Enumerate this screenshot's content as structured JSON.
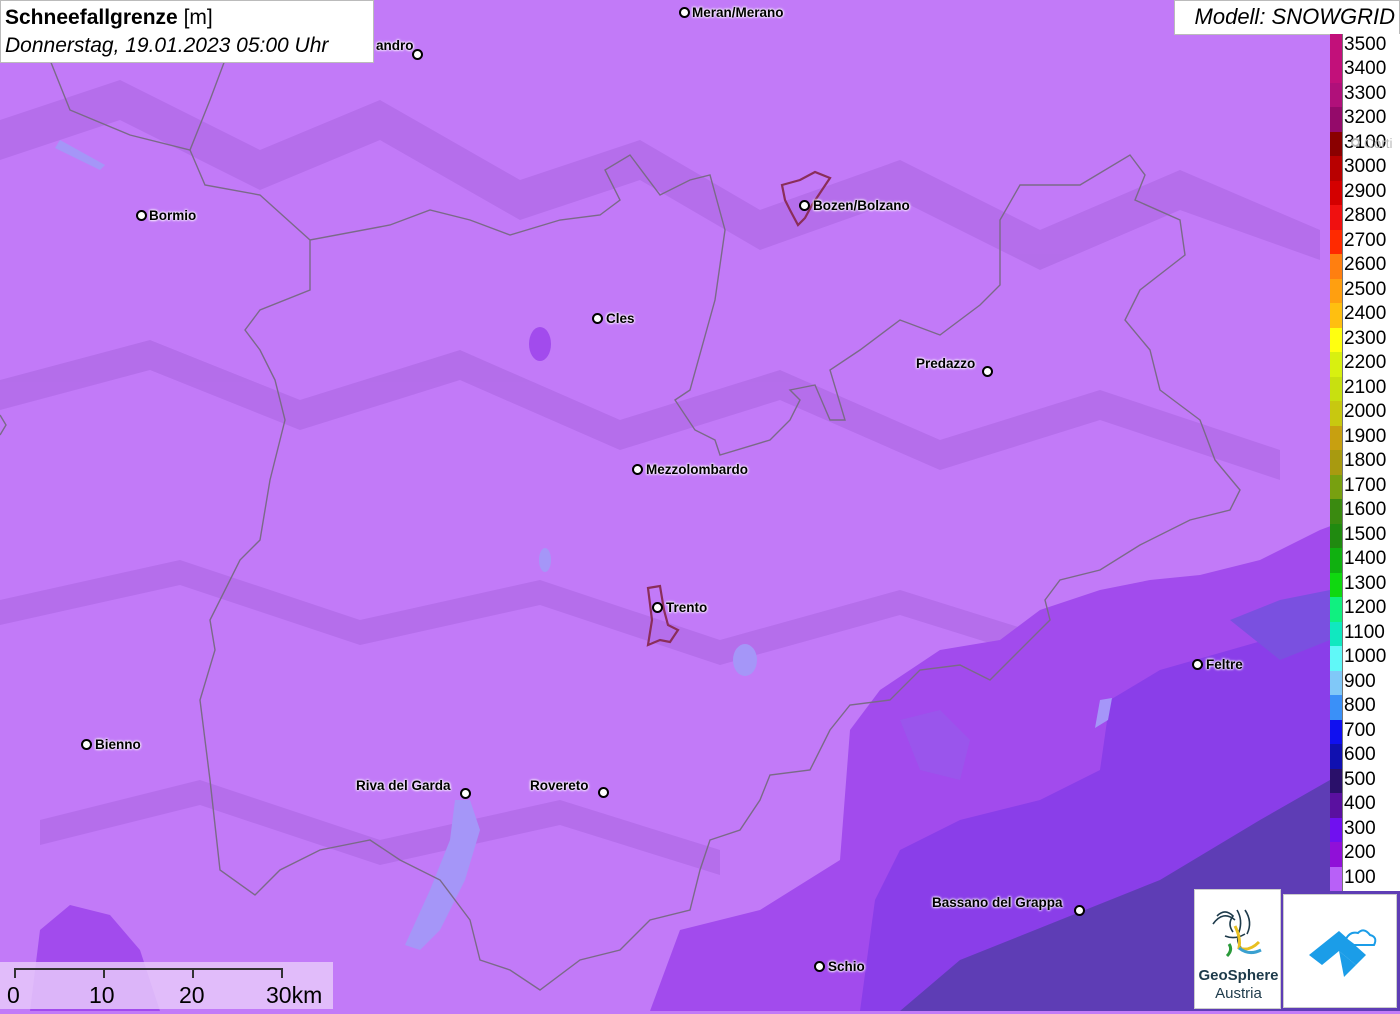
{
  "header": {
    "title_bold": "Schneefallgrenze",
    "title_unit": "[m]",
    "subtitle": "Donnerstag, 19.01.2023 05:00 Uhr"
  },
  "model": {
    "label": "Modell: SNOWGRID"
  },
  "legend": {
    "items": [
      {
        "label": "3500",
        "color": "#c2107a"
      },
      {
        "label": "3400",
        "color": "#c2107a"
      },
      {
        "label": "3300",
        "color": "#b0107a"
      },
      {
        "label": "3200",
        "color": "#940a6a"
      },
      {
        "label": "3100",
        "color": "#8a0000"
      },
      {
        "label": "3000",
        "color": "#b80000"
      },
      {
        "label": "2900",
        "color": "#d40000"
      },
      {
        "label": "2800",
        "color": "#f01010"
      },
      {
        "label": "2700",
        "color": "#ff2a00"
      },
      {
        "label": "2600",
        "color": "#ff7f10"
      },
      {
        "label": "2500",
        "color": "#ff9f10"
      },
      {
        "label": "2400",
        "color": "#ffbf10"
      },
      {
        "label": "2300",
        "color": "#ffff10"
      },
      {
        "label": "2200",
        "color": "#d8f010"
      },
      {
        "label": "2100",
        "color": "#c8e010"
      },
      {
        "label": "2000",
        "color": "#c8c810"
      },
      {
        "label": "1900",
        "color": "#c8a010"
      },
      {
        "label": "1800",
        "color": "#a89a10"
      },
      {
        "label": "1700",
        "color": "#78a010"
      },
      {
        "label": "1600",
        "color": "#3a8a10"
      },
      {
        "label": "1500",
        "color": "#208a10"
      },
      {
        "label": "1400",
        "color": "#10b010"
      },
      {
        "label": "1300",
        "color": "#10d810"
      },
      {
        "label": "1200",
        "color": "#10f080"
      },
      {
        "label": "1100",
        "color": "#10e8c0"
      },
      {
        "label": "1000",
        "color": "#60f8f8"
      },
      {
        "label": "900",
        "color": "#80c8f8"
      },
      {
        "label": "800",
        "color": "#3a90f8"
      },
      {
        "label": "700",
        "color": "#1010f0"
      },
      {
        "label": "600",
        "color": "#1010b0"
      },
      {
        "label": "500",
        "color": "#2a106a"
      },
      {
        "label": "400",
        "color": "#5a10a0"
      },
      {
        "label": "300",
        "color": "#7010f0"
      },
      {
        "label": "200",
        "color": "#9010d8"
      },
      {
        "label": "100",
        "color": "#b860f8"
      }
    ]
  },
  "places": [
    {
      "name": "Meran/Merano"
    },
    {
      "name": "andro"
    },
    {
      "name": "Bormio"
    },
    {
      "name": "Bozen/Bolzano"
    },
    {
      "name": "Cles"
    },
    {
      "name": "Predazzo"
    },
    {
      "name": "Mezzolombardo"
    },
    {
      "name": "Trento"
    },
    {
      "name": "Feltre"
    },
    {
      "name": "Bienno"
    },
    {
      "name": "Riva del Garda"
    },
    {
      "name": "Rovereto"
    },
    {
      "name": "Bassano del Grappa"
    },
    {
      "name": "Schio"
    },
    {
      "name": "Corti"
    }
  ],
  "scale_bar": {
    "labels": [
      "0",
      "10",
      "20",
      "30km"
    ]
  },
  "logos": {
    "geosphere_line1": "GeoSphere",
    "geosphere_line2": "Austria"
  },
  "colors": {
    "background": "#c27af8",
    "zone_mid": "#a24bed",
    "zone_low": "#7e36e8",
    "zone_deep": "#5a38b8",
    "border": "#7a6a88"
  }
}
